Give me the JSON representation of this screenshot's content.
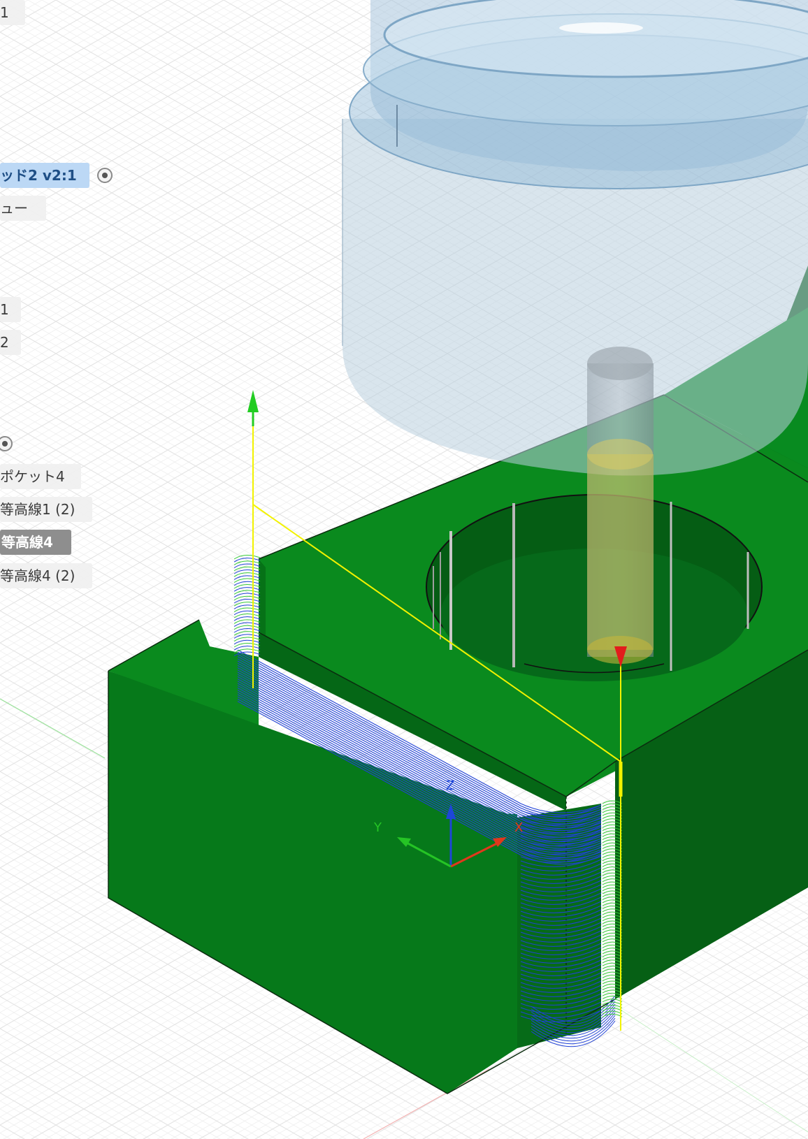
{
  "browser": {
    "top_fragment": "1",
    "component_label": "ッド2 v2:1",
    "view_label": "ュー",
    "item_1": "1",
    "item_2": "2",
    "operations": [
      {
        "label": "ポケット4"
      },
      {
        "label": "等高線1 (2)"
      },
      {
        "label": "等高線4"
      },
      {
        "label": "等高線4 (2)"
      }
    ]
  },
  "viewcube_axes": {
    "x": "X",
    "y": "Y",
    "z": "Z"
  },
  "colors": {
    "stock_green": "#0a7e1a",
    "toolpath_blue": "#1f3fd0",
    "rapid_yellow": "#f2f200",
    "holder_blue": "#a9c7de",
    "grid": "#e2e2e2"
  }
}
